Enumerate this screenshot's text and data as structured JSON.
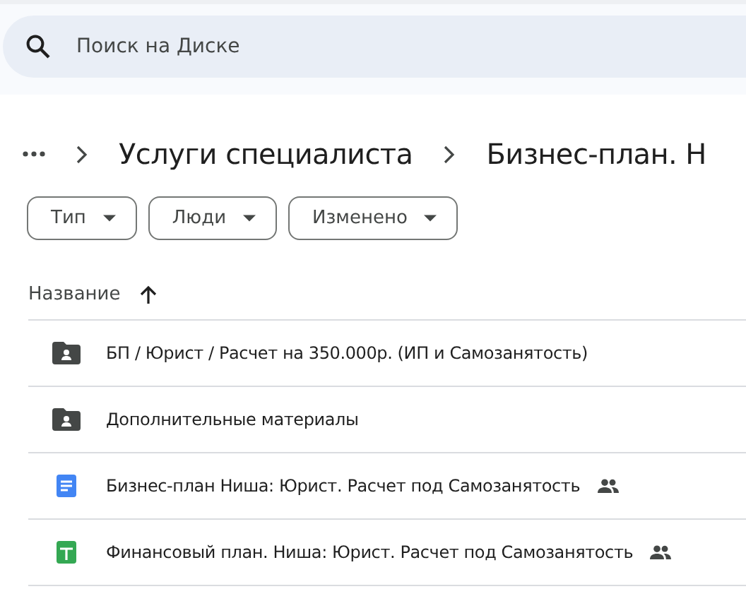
{
  "search": {
    "placeholder": "Поиск на Диске"
  },
  "breadcrumbs": [
    "Услуги специалиста",
    "Бизнес-план. Н"
  ],
  "filters": [
    "Тип",
    "Люди",
    "Изменено"
  ],
  "table": {
    "columns": [
      {
        "label": "Название",
        "sorted_ascending": true
      }
    ],
    "rows": [
      {
        "kind": "folder",
        "name": "БП / Юрист / Расчет на 350.000р. (ИП и Самозанятость)",
        "shared": false
      },
      {
        "kind": "folder",
        "name": "Дополнительные материалы",
        "shared": false
      },
      {
        "kind": "doc",
        "name": "Бизнес-план Ниша: Юрист. Расчет под Самозанятость",
        "shared": true
      },
      {
        "kind": "sheet",
        "name": "Финансовый план. Ниша: Юрист. Расчет под Самозанятость",
        "shared": true
      }
    ]
  }
}
